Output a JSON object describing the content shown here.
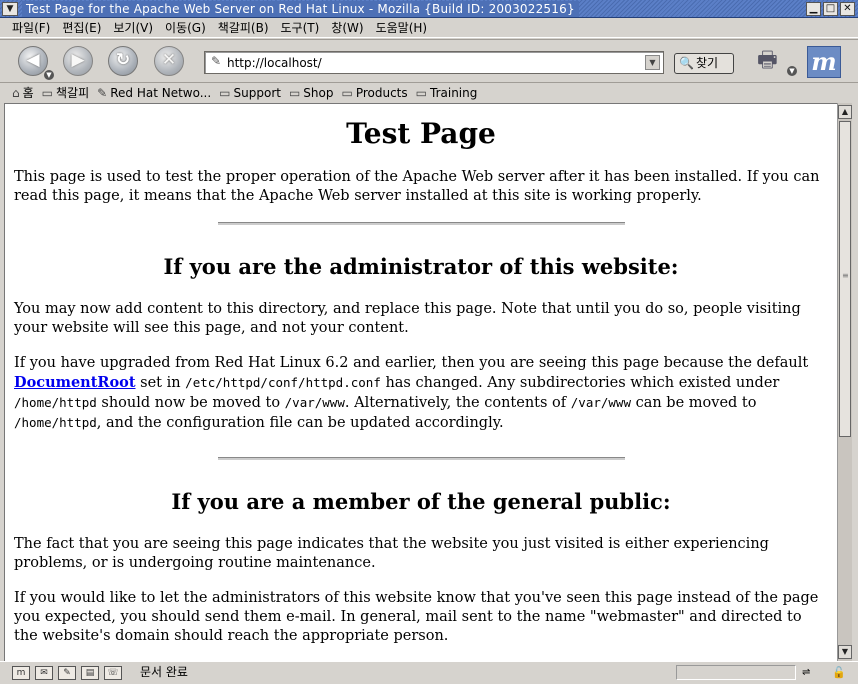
{
  "window": {
    "title": "Test Page for the Apache Web Server on Red Hat Linux - Mozilla {Build ID: 2003022516}",
    "controls": {
      "minimize": "▁",
      "maximize": "□",
      "close": "✕"
    }
  },
  "menubar": {
    "items": [
      "파일(F)",
      "편집(E)",
      "보기(V)",
      "이동(G)",
      "책갈피(B)",
      "도구(T)",
      "창(W)",
      "도움말(H)"
    ]
  },
  "navbar": {
    "back_icon": "◀",
    "forward_icon": "▶",
    "reload_icon": "↻",
    "stop_icon": "✕",
    "url": "http://localhost/",
    "search_label": "찾기"
  },
  "personal_toolbar": {
    "items": [
      {
        "icon": "home-icon",
        "glyph": "⌂",
        "label": "홈"
      },
      {
        "icon": "folder-icon",
        "glyph": "▭",
        "label": "책갈피"
      },
      {
        "icon": "bookmark-icon",
        "glyph": "✎",
        "label": "Red Hat Netwo..."
      },
      {
        "icon": "folder-icon",
        "glyph": "▭",
        "label": "Support"
      },
      {
        "icon": "folder-icon",
        "glyph": "▭",
        "label": "Shop"
      },
      {
        "icon": "folder-icon",
        "glyph": "▭",
        "label": "Products"
      },
      {
        "icon": "folder-icon",
        "glyph": "▭",
        "label": "Training"
      }
    ]
  },
  "page": {
    "title": "Test Page",
    "intro": "This page is used to test the proper operation of the Apache Web server after it has been installed. If you can read this page, it means that the Apache Web server installed at this site is working properly.",
    "admin_heading": "If you are the administrator of this website:",
    "admin_p1": "You may now add content to this directory, and replace this page. Note that until you do so, people visiting your website will see this page, and not your content.",
    "admin_p2": {
      "t1": "If you have upgraded from Red Hat Linux 6.2 and earlier, then you are seeing this page because the default ",
      "link": "DocumentRoot",
      "t2": " set in ",
      "code1": "/etc/httpd/conf/httpd.conf",
      "t3": " has changed. Any subdirectories which existed under ",
      "code2": "/home/httpd",
      "t4": " should now be moved to ",
      "code3": "/var/www",
      "t5": ". Alternatively, the contents of ",
      "code4": "/var/www",
      "t6": " can be moved to ",
      "code5": "/home/httpd",
      "t7": ", and the configuration file can be updated accordingly."
    },
    "public_heading": "If you are a member of the general public:",
    "public_p1": "The fact that you are seeing this page indicates that the website you just visited is either experiencing problems, or is undergoing routine maintenance.",
    "public_p2": "If you would like to let the administrators of this website know that you've seen this page instead of the page you expected, you should send them e-mail. In general, mail sent to the name \"webmaster\" and directed to the website's domain should reach the appropriate person."
  },
  "statusbar": {
    "text": "문서 완료"
  },
  "colors": {
    "titlebar": "#5b7fc7",
    "chrome": "#d6d3ce",
    "link": "#0000ee"
  }
}
